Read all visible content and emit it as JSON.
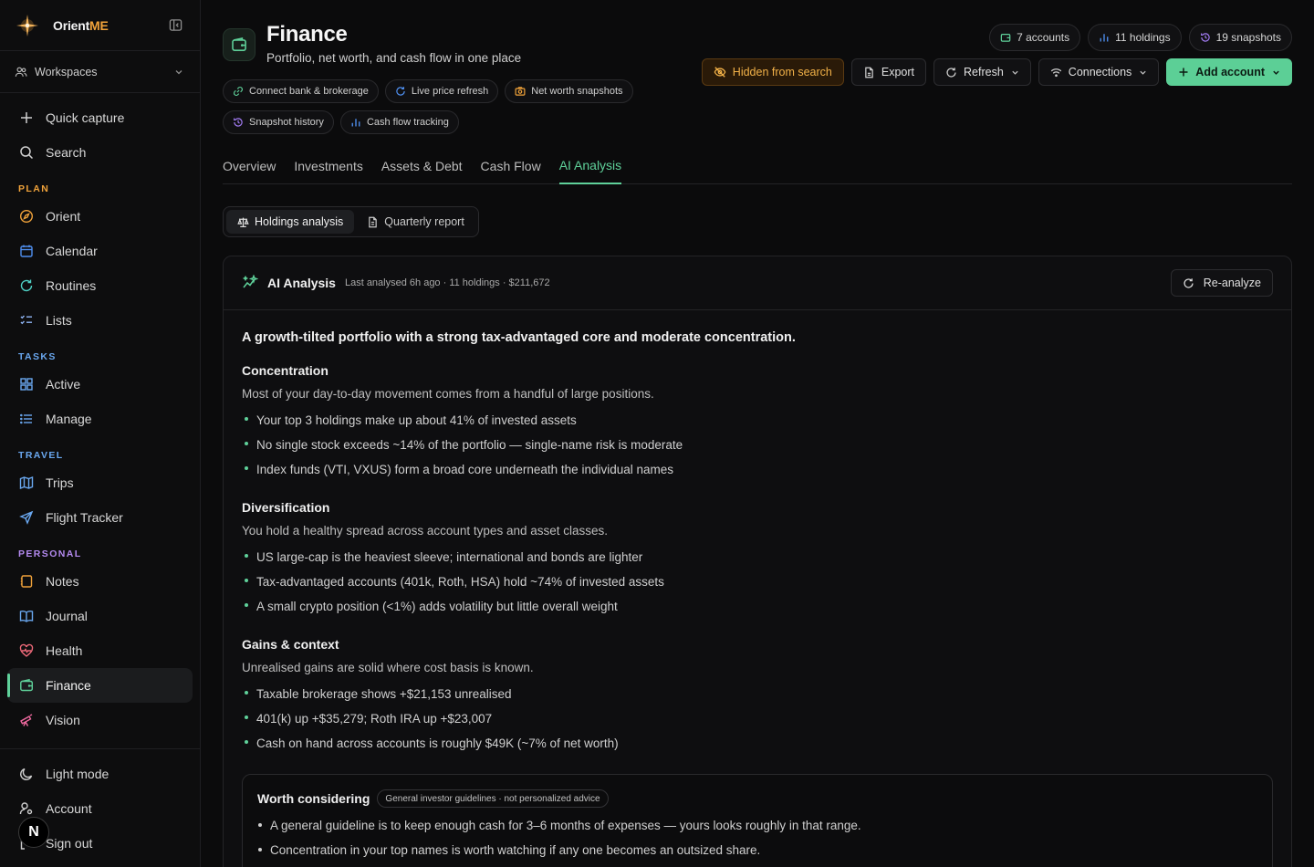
{
  "app": {
    "name_prefix": "Orient",
    "name_suffix": "ME"
  },
  "colors": {
    "accent": "#5fd19a",
    "brand": "#f0a23a",
    "warn": "#f2b148"
  },
  "sidebar": {
    "workspace_label": "Workspaces",
    "quick": [
      {
        "label": "Quick capture",
        "icon": "plus-icon"
      },
      {
        "label": "Search",
        "icon": "search-icon"
      }
    ],
    "sections": [
      {
        "label": "PLAN",
        "color": "#f0a23a",
        "items": [
          {
            "label": "Orient",
            "icon": "compass-icon"
          },
          {
            "label": "Calendar",
            "icon": "calendar-icon"
          },
          {
            "label": "Routines",
            "icon": "refresh-icon"
          },
          {
            "label": "Lists",
            "icon": "checklist-icon"
          }
        ]
      },
      {
        "label": "TASKS",
        "color": "#6aa8f0",
        "items": [
          {
            "label": "Active",
            "icon": "grid-icon"
          },
          {
            "label": "Manage",
            "icon": "list-icon"
          }
        ]
      },
      {
        "label": "TRAVEL",
        "color": "#6aa8f0",
        "items": [
          {
            "label": "Trips",
            "icon": "map-icon"
          },
          {
            "label": "Flight Tracker",
            "icon": "plane-icon"
          }
        ]
      },
      {
        "label": "PERSONAL",
        "color": "#b48af0",
        "items": [
          {
            "label": "Notes",
            "icon": "notebook-icon"
          },
          {
            "label": "Journal",
            "icon": "book-icon"
          },
          {
            "label": "Health",
            "icon": "heart-pulse-icon"
          },
          {
            "label": "Finance",
            "icon": "wallet-icon"
          },
          {
            "label": "Vision",
            "icon": "telescope-icon"
          }
        ]
      }
    ],
    "bottom": [
      {
        "label": "Light mode",
        "icon": "moon-icon"
      },
      {
        "label": "Account",
        "icon": "user-cog-icon"
      },
      {
        "label": "Sign out",
        "icon": "logout-icon"
      }
    ],
    "avatar_letter": "N"
  },
  "header": {
    "title": "Finance",
    "subtitle": "Portfolio, net worth, and cash flow in one place",
    "chips": [
      {
        "label": "Connect bank & brokerage",
        "icon": "link-icon",
        "color": "#5fd19a"
      },
      {
        "label": "Live price refresh",
        "icon": "refresh-icon",
        "color": "#4f8ff0"
      },
      {
        "label": "Net worth snapshots",
        "icon": "camera-icon",
        "color": "#f0a23a"
      },
      {
        "label": "Snapshot history",
        "icon": "history-icon",
        "color": "#a07af0"
      },
      {
        "label": "Cash flow tracking",
        "icon": "bar-chart-icon",
        "color": "#4f8ff0"
      }
    ],
    "stats": [
      {
        "label": "7 accounts",
        "icon": "wallet-icon",
        "color": "#5fd19a"
      },
      {
        "label": "11 holdings",
        "icon": "bar-chart-icon",
        "color": "#4f8ff0"
      },
      {
        "label": "19 snapshots",
        "icon": "history-icon",
        "color": "#a07af0"
      }
    ],
    "actions": {
      "hidden": "Hidden from search",
      "export": "Export",
      "refresh": "Refresh",
      "connections": "Connections",
      "add": "Add account"
    }
  },
  "tabs": [
    "Overview",
    "Investments",
    "Assets & Debt",
    "Cash Flow",
    "AI Analysis"
  ],
  "active_tab": "AI Analysis",
  "segments": {
    "holdings": "Holdings analysis",
    "quarterly": "Quarterly report"
  },
  "analysis": {
    "title": "AI Analysis",
    "meta": "Last analysed 6h ago · 11 holdings · $211,672",
    "reanalyze": "Re-analyze",
    "summary": "A growth-tilted portfolio with a strong tax-advantaged core and moderate concentration.",
    "sections": [
      {
        "heading": "Concentration",
        "intro": "Most of your day-to-day movement comes from a handful of large positions.",
        "bullets": [
          "Your top 3 holdings make up about 41% of invested assets",
          "No single stock exceeds ~14% of the portfolio — single-name risk is moderate",
          "Index funds (VTI, VXUS) form a broad core underneath the individual names"
        ]
      },
      {
        "heading": "Diversification",
        "intro": "You hold a healthy spread across account types and asset classes.",
        "bullets": [
          "US large-cap is the heaviest sleeve; international and bonds are lighter",
          "Tax-advantaged accounts (401k, Roth, HSA) hold ~74% of invested assets",
          "A small crypto position (<1%) adds volatility but little overall weight"
        ]
      },
      {
        "heading": "Gains & context",
        "intro": "Unrealised gains are solid where cost basis is known.",
        "bullets": [
          "Taxable brokerage shows +$21,153 unrealised",
          "401(k) up +$35,279; Roth IRA up +$23,007",
          "Cash on hand across accounts is roughly $49K (~7% of net worth)"
        ]
      }
    ],
    "consider": {
      "title": "Worth considering",
      "badge": "General investor guidelines · not personalized advice",
      "items": [
        "A general guideline is to keep enough cash for 3–6 months of expenses — yours looks roughly in that range.",
        "Concentration in your top names is worth watching if any one becomes an outsized share."
      ]
    }
  }
}
